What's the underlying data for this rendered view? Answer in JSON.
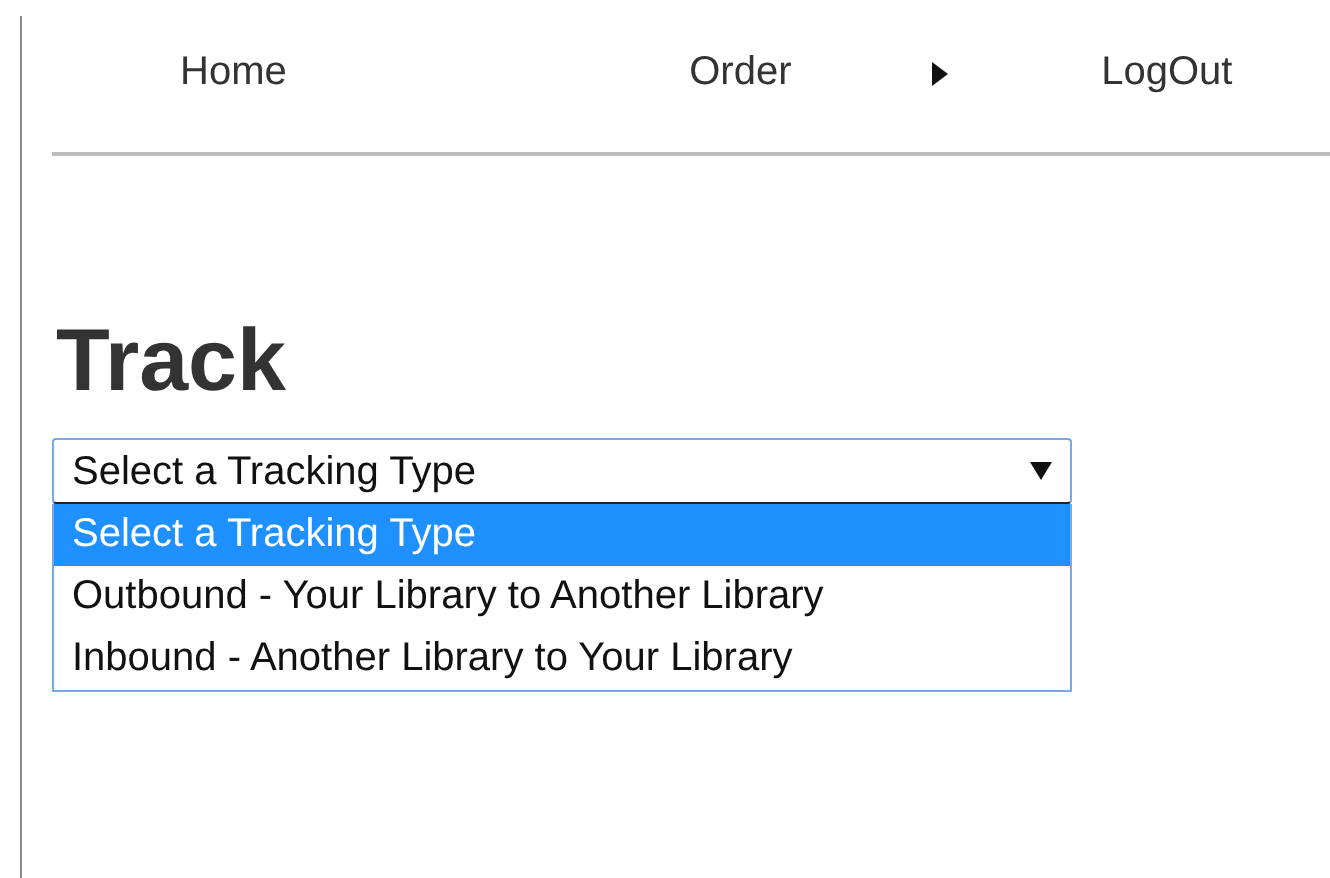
{
  "nav": {
    "items": [
      {
        "label": "Home",
        "submenu": false
      },
      {
        "label": "Order",
        "submenu": true
      },
      {
        "label": "LogOut",
        "submenu": false
      }
    ]
  },
  "heading": "Track",
  "select": {
    "value": "Select a Tracking Type",
    "expanded": true,
    "options": [
      {
        "label": "Select a Tracking Type",
        "selected": true
      },
      {
        "label": "Outbound - Your Library to Another Library",
        "selected": false
      },
      {
        "label": "Inbound - Another Library to Your Library",
        "selected": false
      }
    ]
  }
}
